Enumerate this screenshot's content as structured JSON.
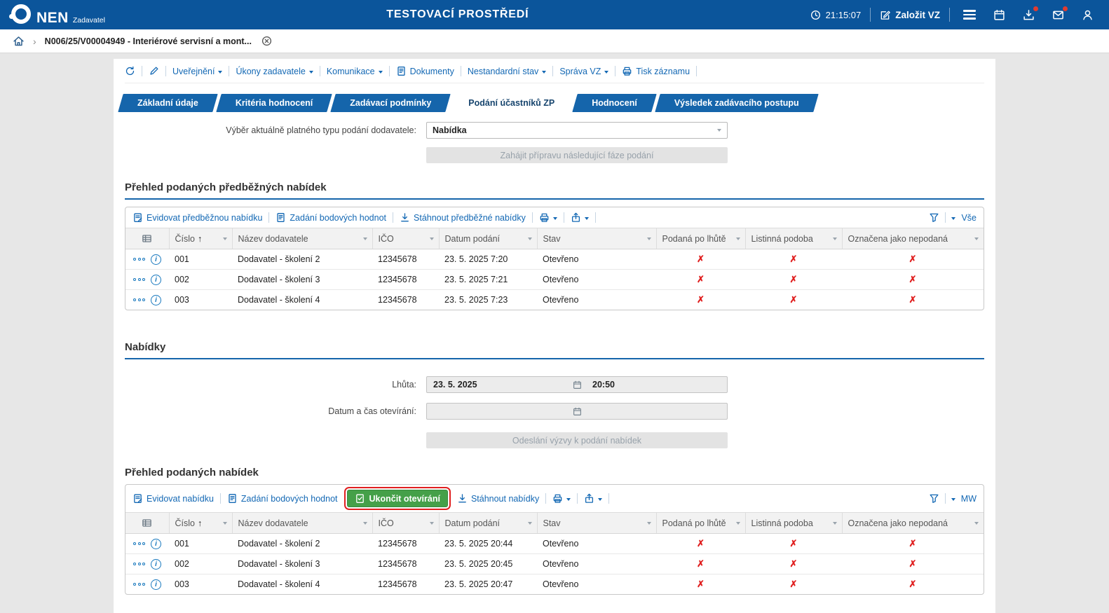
{
  "topbar": {
    "logo_text": "NEN",
    "logo_sub": "Zadavatel",
    "env_title": "TESTOVACÍ PROSTŘEDÍ",
    "clock": "21:15:07",
    "create_vz_label": "Založit VZ"
  },
  "breadcrumb": {
    "separator": "›",
    "item_label": "N006/25/V00004949 - Interiérové servisní a mont..."
  },
  "record_toolbar": {
    "links": [
      {
        "label": "Uveřejnění"
      },
      {
        "label": "Úkony zadavatele"
      },
      {
        "label": "Komunikace"
      },
      {
        "label": "Dokumenty"
      },
      {
        "label": "Nestandardní stav"
      },
      {
        "label": "Správa VZ"
      },
      {
        "label": "Tisk záznamu"
      }
    ]
  },
  "tabs": [
    {
      "label": "Základní údaje"
    },
    {
      "label": "Kritéria hodnocení"
    },
    {
      "label": "Zadávací podmínky"
    },
    {
      "label": "Podání účastníků ZP"
    },
    {
      "label": "Hodnocení"
    },
    {
      "label": "Výsledek zadávacího postupu"
    }
  ],
  "submission_type": {
    "label": "Výběr aktuálně platného typu podání dodavatele:",
    "value": "Nabídka"
  },
  "buttons": {
    "next_phase": "Zahájit přípravu následující fáze podání",
    "send_invitation": "Odeslání výzvy k podání nabídek",
    "end_opening": "Ukončit otevírání"
  },
  "table_headers": [
    "Číslo",
    "Název dodavatele",
    "IČO",
    "Datum podání",
    "Stav",
    "Podaná po lhůtě",
    "Listinná podoba",
    "Označena jako nepodaná"
  ],
  "icons": {
    "cross": "✗",
    "sort_asc": "↑",
    "info": "i"
  },
  "prelim": {
    "title": "Přehled podaných předběžných nabídek",
    "actions": [
      "Evidovat předběžnou nabídku",
      "Zadání bodových hodnot",
      "Stáhnout předběžné nabídky"
    ],
    "view_filter": "Vše",
    "rows": [
      {
        "number": "001",
        "supplier": "Dodavatel - školení 2",
        "ico": "12345678",
        "date": "23. 5. 2025 7:20",
        "status": "Otevřeno"
      },
      {
        "number": "002",
        "supplier": "Dodavatel - školení 3",
        "ico": "12345678",
        "date": "23. 5. 2025 7:21",
        "status": "Otevřeno"
      },
      {
        "number": "003",
        "supplier": "Dodavatel - školení 4",
        "ico": "12345678",
        "date": "23. 5. 2025 7:23",
        "status": "Otevřeno"
      }
    ]
  },
  "offers_form": {
    "section_title": "Nabídky",
    "deadline_label": "Lhůta:",
    "deadline_date": "23. 5. 2025",
    "deadline_time": "20:50",
    "opening_label": "Datum a čas otevírání:",
    "opening_date": "",
    "opening_time": ""
  },
  "offers": {
    "title": "Přehled podaných nabídek",
    "actions": [
      "Evidovat nabídku",
      "Zadání bodových hodnot",
      "Stáhnout nabídky"
    ],
    "view_filter": "MW",
    "rows": [
      {
        "number": "001",
        "supplier": "Dodavatel - školení 2",
        "ico": "12345678",
        "date": "23. 5. 2025 20:44",
        "status": "Otevřeno"
      },
      {
        "number": "002",
        "supplier": "Dodavatel - školení 3",
        "ico": "12345678",
        "date": "23. 5. 2025 20:45",
        "status": "Otevřeno"
      },
      {
        "number": "003",
        "supplier": "Dodavatel - školení 4",
        "ico": "12345678",
        "date": "23. 5. 2025 20:47",
        "status": "Otevřeno"
      }
    ]
  }
}
